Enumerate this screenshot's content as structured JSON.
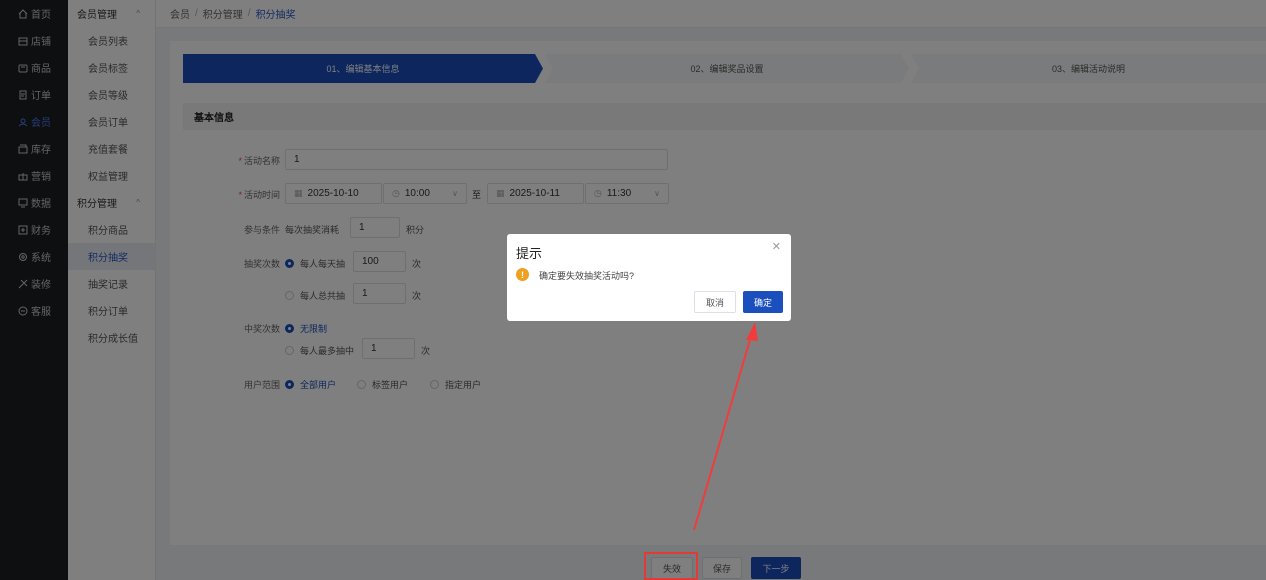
{
  "nav": {
    "items": [
      {
        "label": "首页",
        "icon": "home-icon"
      },
      {
        "label": "店铺",
        "icon": "store-icon"
      },
      {
        "label": "商品",
        "icon": "goods-icon"
      },
      {
        "label": "订单",
        "icon": "order-icon"
      },
      {
        "label": "会员",
        "icon": "member-icon"
      },
      {
        "label": "库存",
        "icon": "inventory-icon"
      },
      {
        "label": "营销",
        "icon": "gift-icon"
      },
      {
        "label": "数据",
        "icon": "data-icon"
      },
      {
        "label": "财务",
        "icon": "finance-icon"
      },
      {
        "label": "系统",
        "icon": "gear-icon"
      },
      {
        "label": "装修",
        "icon": "decorate-icon"
      },
      {
        "label": "客服",
        "icon": "chat-icon"
      }
    ],
    "active_index": 4
  },
  "submenu": {
    "group1": "会员管理",
    "items1": [
      "会员列表",
      "会员标签",
      "会员等级",
      "会员订单",
      "充值套餐",
      "权益管理"
    ],
    "group2": "积分管理",
    "items2": [
      "积分商品",
      "积分抽奖",
      "抽奖记录",
      "积分订单",
      "积分成长值"
    ],
    "active": "积分抽奖"
  },
  "breadcrumb": [
    "会员",
    "积分管理",
    "积分抽奖"
  ],
  "steps": [
    "01、编辑基本信息",
    "02、编辑奖品设置",
    "03、编辑活动说明"
  ],
  "section_title": "基本信息",
  "form": {
    "name_label": "活动名称",
    "name_value": "1",
    "time_label": "活动时间",
    "start_date": "2025-10-10",
    "start_time": "10:00",
    "to": "至",
    "end_date": "2025-10-11",
    "end_time": "11:30",
    "cond_label": "参与条件",
    "cond_prefix": "每次抽奖消耗",
    "cond_value": "1",
    "cond_suffix": "积分",
    "draw_label": "抽奖次数",
    "draw_opt1": "每人每天抽",
    "draw_opt1_value": "100",
    "draw_opt2": "每人总共抽",
    "draw_opt2_value": "1",
    "times_unit": "次",
    "win_label": "中奖次数",
    "win_opt1": "无限制",
    "win_opt2": "每人最多抽中",
    "win_opt2_value": "1",
    "scope_label": "用户范围",
    "scope_opt1": "全部用户",
    "scope_opt2": "标签用户",
    "scope_opt3": "指定用户"
  },
  "footer": {
    "disable": "失效",
    "save": "保存",
    "next": "下一步"
  },
  "dialog": {
    "title": "提示",
    "message": "确定要失效抽奖活动吗?",
    "cancel": "取消",
    "confirm": "确定"
  },
  "colors": {
    "primary": "#1b4fbd",
    "highlight": "#e53935",
    "warning": "#f0a020"
  }
}
